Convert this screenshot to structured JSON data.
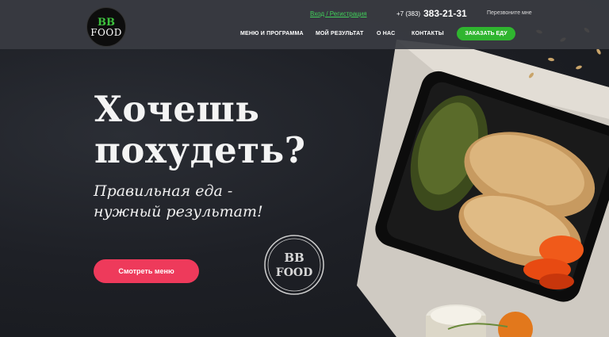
{
  "logo": {
    "line1": "BB",
    "line2": "FOOD"
  },
  "header": {
    "login_link": "Вход / Регистрация",
    "phone_prefix": "+7 (383)",
    "phone_number": "383-21-31",
    "callback_link": "Перезвоните мне",
    "nav": [
      "МЕНЮ И ПРОГРАММА",
      "МОЙ РЕЗУЛЬТАТ",
      "О НАС",
      "КОНТАКТЫ"
    ],
    "order_button": "ЗАКАЗАТЬ ЕДУ"
  },
  "hero": {
    "title_line1": "Хочешь",
    "title_line2": "похудеть?",
    "subtitle_line1": "Правильная еда -",
    "subtitle_line2": "нужный результат!",
    "menu_button": "Смотреть меню",
    "stamp_line1": "BB",
    "stamp_line2": "FOOD"
  },
  "colors": {
    "accent_green": "#2fb52f",
    "link_green": "#41d05a",
    "cta_pink": "#ee3a5b",
    "background": "#1b1d22"
  }
}
